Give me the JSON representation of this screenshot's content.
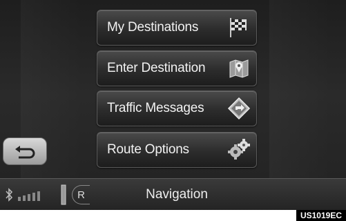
{
  "menu": {
    "items": [
      {
        "label": "My Destinations",
        "icon": "checkered-flag-icon"
      },
      {
        "label": "Enter Destination",
        "icon": "map-pin-icon"
      },
      {
        "label": "Traffic Messages",
        "icon": "traffic-diamond-icon"
      },
      {
        "label": "Route Options",
        "icon": "gears-icon"
      }
    ]
  },
  "back_button": {
    "icon": "return-arrow-icon"
  },
  "status_bar": {
    "title": "Navigation",
    "r_label": "R",
    "icons": [
      "bluetooth-icon",
      "signal-bars-icon",
      "battery-icon"
    ]
  },
  "caption": "US1019EC"
}
